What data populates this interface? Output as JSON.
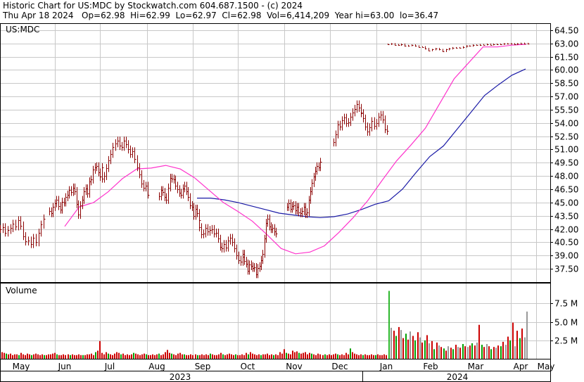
{
  "header": {
    "line1": "Historic Chart for US:MDC by Stockwatch.com 604.687.1500 - (c) 2024",
    "line2": "Thu Apr 18 2024   Op=62.98  Hi=62.99  Lo=62.97  Cl=62.98  Vol=6,414,209  Year hi=63.00  lo=36.47"
  },
  "colors": {
    "price_bar": "#8b0000",
    "ma_short": "#ff33cc",
    "ma_long": "#1a1aa6",
    "volume_bar": "#cc0000",
    "volume_bar_alt": "#00a000",
    "grid": "#c8c8c8",
    "frame": "#000000"
  },
  "chart_data": [
    {
      "type": "ohlc",
      "title": "US:MDC",
      "symbol_label": "US:MDC",
      "y_axis_side": "right",
      "ylim": [
        36.0,
        65.2
      ],
      "yticks": [
        "64.50",
        "63.00",
        "61.50",
        "60.00",
        "58.50",
        "57.00",
        "55.50",
        "54.00",
        "52.50",
        "51.00",
        "49.50",
        "48.00",
        "46.50",
        "45.00",
        "43.50",
        "42.00",
        "40.50",
        "39.00",
        "37.50"
      ],
      "grid": true,
      "x_months": [
        "May",
        "Jun",
        "Jul",
        "Aug",
        "Sep",
        "Oct",
        "Nov",
        "Dec",
        "Jan",
        "Feb",
        "Mar",
        "Apr",
        "May"
      ],
      "years": [
        "2023",
        "2024"
      ],
      "closes_daily": [
        [
          42.0,
          42.2,
          41.6,
          41.9,
          42.1,
          42.6,
          42.3,
          43.0,
          42.4,
          41.2,
          40.6,
          40.7,
          40.3,
          41.0,
          40.5,
          41.6,
          42.5,
          43.2
        ],
        [
          44.0,
          43.8,
          44.5,
          44.9,
          45.3,
          44.6,
          44.2,
          45.1,
          45.0,
          45.6,
          45.9,
          46.4,
          46.2,
          46.7,
          46.3,
          44.8,
          43.6,
          44.7,
          45.3,
          46.3,
          46.6,
          46.0,
          47.4,
          47.6,
          48.7,
          49.0,
          49.1,
          48.4,
          47.9,
          49.0
        ],
        [
          47.7,
          48.0,
          48.9,
          49.8,
          50.5,
          51.3,
          51.7,
          52.0,
          51.4,
          51.3,
          52.0,
          51.6,
          51.0,
          50.5,
          50.8,
          49.9,
          49.0,
          48.2,
          47.1,
          46.7,
          46.9,
          45.9
        ],
        [
          45.7,
          46.4,
          46.2,
          45.6,
          45.3,
          46.7,
          47.8,
          47.7,
          47.6,
          46.9,
          46.5,
          46.1,
          45.9,
          46.6,
          46.9,
          46.3,
          45.6,
          44.7,
          44.5,
          43.5,
          44.3,
          43.8,
          43.0
        ],
        [
          42.2,
          41.4,
          41.5,
          42.1,
          41.7,
          41.9,
          42.0,
          41.5,
          41.6,
          40.9,
          40.0,
          39.8,
          40.3,
          39.9,
          40.7,
          41.0,
          40.5,
          39.8,
          39.0,
          38.5,
          38.3,
          38.9
        ],
        [
          39.2,
          38.4,
          38.1,
          37.3,
          38.0,
          37.8,
          37.6,
          37.7,
          36.9,
          37.6,
          37.8,
          38.5,
          39.2,
          40.9,
          42.7,
          43.2,
          42.3,
          42.0,
          42.1,
          41.7,
          41.5
        ],
        [
          44.5,
          44.9,
          44.3,
          44.6,
          44.7,
          44.1,
          44.5,
          43.9,
          43.8,
          44.0,
          44.5,
          43.7,
          43.9,
          45.3,
          46.3,
          47.2,
          47.9,
          48.6,
          49.1,
          49.0,
          49.6
        ],
        [
          51.8,
          52.7,
          53.8,
          53.6,
          54.3,
          54.6,
          54.0,
          54.1,
          54.7,
          55.2,
          55.6,
          56.1,
          55.7,
          55.2
        ],
        [
          55.1,
          54.5,
          53.6,
          53.0,
          53.5,
          54.2,
          53.7,
          54.0,
          54.7,
          54.9,
          54.4,
          53.3,
          53.1
        ],
        [
          62.9,
          62.95,
          62.85,
          62.8,
          62.9,
          62.7,
          62.75,
          62.8,
          62.7,
          62.6,
          62.6,
          62.4,
          62.2,
          62.3,
          62.4,
          62.3,
          62.1,
          62.3,
          62.4,
          62.5,
          62.5,
          62.5,
          62.6,
          62.7,
          62.7,
          62.8,
          62.8,
          62.85,
          62.85,
          62.9,
          62.85,
          62.9,
          62.9,
          62.9,
          62.95,
          62.95,
          62.95,
          62.9,
          62.95,
          63.0,
          62.95,
          62.98
        ]
      ],
      "ma_short": [
        [
          42.3,
          44.5,
          45.0,
          46.2,
          47.7,
          48.8,
          48.9,
          49.2,
          48.8,
          47.8,
          46.4,
          45.0,
          44.0,
          42.9,
          41.4,
          39.8,
          39.2,
          39.4,
          40.1,
          41.6,
          43.3,
          45.2,
          47.5,
          49.7,
          51.5,
          53.4,
          56.2,
          59.0,
          60.8,
          62.6,
          62.6,
          62.8,
          62.9
        ],
        [
          "Jun",
          "Jun",
          "Jul",
          "Jul",
          "Aug",
          "Aug",
          "Aug",
          "Sep",
          "Sep",
          "Sep",
          "Sep",
          "Oct",
          "Oct",
          "Oct",
          "Oct",
          "Oct",
          "Oct",
          "Nov",
          "Nov",
          "Nov",
          "Nov",
          "Dec",
          "Dec",
          "Dec",
          "Jan",
          "Jan",
          "Jan",
          "Feb",
          "Feb",
          "Feb",
          "Mar",
          "Apr",
          "Apr"
        ]
      ],
      "ma_long": [
        [
          45.5,
          45.5,
          45.3,
          45.0,
          44.6,
          44.2,
          43.8,
          43.6,
          43.4,
          43.3,
          43.4,
          43.7,
          44.2,
          44.8,
          45.2,
          46.5,
          48.4,
          50.2,
          51.4,
          53.3,
          55.2,
          57.1,
          58.3,
          59.4,
          60.1
        ],
        [
          "Sep",
          "Sep",
          "Oct",
          "Oct",
          "Oct",
          "Nov",
          "Nov",
          "Nov",
          "Nov",
          "Dec",
          "Dec",
          "Dec",
          "Jan",
          "Jan",
          "Jan",
          "Jan",
          "Feb",
          "Feb",
          "Feb",
          "Mar",
          "Mar",
          "Mar",
          "Apr",
          "Apr",
          "Apr"
        ]
      ]
    },
    {
      "type": "bar",
      "title": "Volume",
      "ylim": [
        0,
        10.2
      ],
      "yticks": [
        "7.5 M",
        "5.0 M",
        "2.5 M"
      ],
      "units": "M",
      "volume_m_segments": [
        [
          0.9,
          0.8,
          0.7,
          0.6,
          0.7,
          0.5,
          0.6,
          0.6,
          0.5,
          0.8,
          0.6,
          0.5,
          0.7,
          0.6,
          0.5,
          0.6,
          0.7,
          0.6,
          0.5,
          0.6,
          0.5,
          0.5,
          0.6,
          0.6,
          0.7,
          0.8,
          0.6,
          0.5,
          0.5,
          0.6,
          0.5,
          0.6,
          0.5,
          0.6,
          0.5,
          0.5,
          0.6,
          0.5,
          0.5,
          0.5,
          0.6,
          0.6,
          0.7,
          0.5,
          0.9,
          1.1,
          2.4,
          0.8,
          0.6,
          0.9,
          0.7,
          0.6,
          0.5,
          0.7,
          0.9,
          0.8,
          0.6,
          0.7,
          0.5,
          0.6,
          0.5,
          0.6,
          0.8,
          0.7,
          0.6,
          0.5,
          0.6,
          0.7,
          0.6,
          0.5,
          0.5,
          0.6,
          0.5,
          0.6,
          0.7,
          0.5,
          0.6,
          0.9,
          1.2,
          0.8,
          0.7,
          0.6,
          0.5,
          0.7,
          0.8,
          0.6,
          0.6,
          0.5,
          0.5,
          0.6,
          0.5,
          0.6,
          0.5,
          0.5,
          0.6,
          0.5,
          0.6,
          0.5,
          0.7,
          0.6,
          0.5,
          0.5,
          0.6,
          0.8,
          0.6,
          0.5,
          0.6,
          0.7,
          0.6,
          0.5,
          0.6,
          0.5,
          0.5,
          0.6,
          0.5,
          0.8,
          0.6,
          0.9,
          0.7,
          0.6,
          0.5,
          0.6,
          0.5,
          0.6,
          0.6,
          0.7,
          0.5,
          0.6,
          0.5,
          0.6,
          0.5,
          0.9,
          0.7,
          1.3,
          0.8,
          0.7,
          0.6,
          1.1,
          0.9,
          1.0,
          0.8,
          0.7,
          0.8,
          0.9,
          0.6,
          0.8,
          0.7,
          0.6,
          0.5,
          0.7,
          0.6,
          0.5,
          0.6,
          0.5,
          0.6,
          0.5,
          0.6,
          0.7,
          0.6,
          0.5,
          0.6,
          0.5,
          0.8,
          0.6,
          1.4,
          0.9,
          0.7,
          0.6,
          0.5,
          0.6,
          0.5,
          0.6,
          0.5,
          0.5,
          0.6,
          0.5,
          0.5,
          0.6,
          0.5,
          0.5,
          0.6,
          0.5
        ],
        [
          9.2,
          4.2,
          3.8,
          3.1,
          4.3,
          3.9,
          2.8,
          3.4,
          2.6,
          3.7,
          3.1,
          2.5,
          3.6,
          2.9,
          2.2,
          2.5,
          3.2,
          2.1,
          2.4,
          1.3,
          2.2,
          1.8,
          1.6,
          1.4,
          1.1,
          1.7,
          1.5,
          1.3,
          1.9,
          1.6,
          1.5,
          2.0,
          1.7,
          1.6,
          1.8,
          2.1,
          1.8,
          2.2,
          4.6,
          1.9,
          1.6,
          2.0,
          1.7,
          1.3,
          1.6,
          1.5,
          1.8,
          1.7,
          2.3,
          1.9,
          3.0,
          2.5,
          4.9,
          1.7,
          3.8,
          2.8,
          4.1,
          2.9,
          6.4
        ]
      ]
    }
  ]
}
